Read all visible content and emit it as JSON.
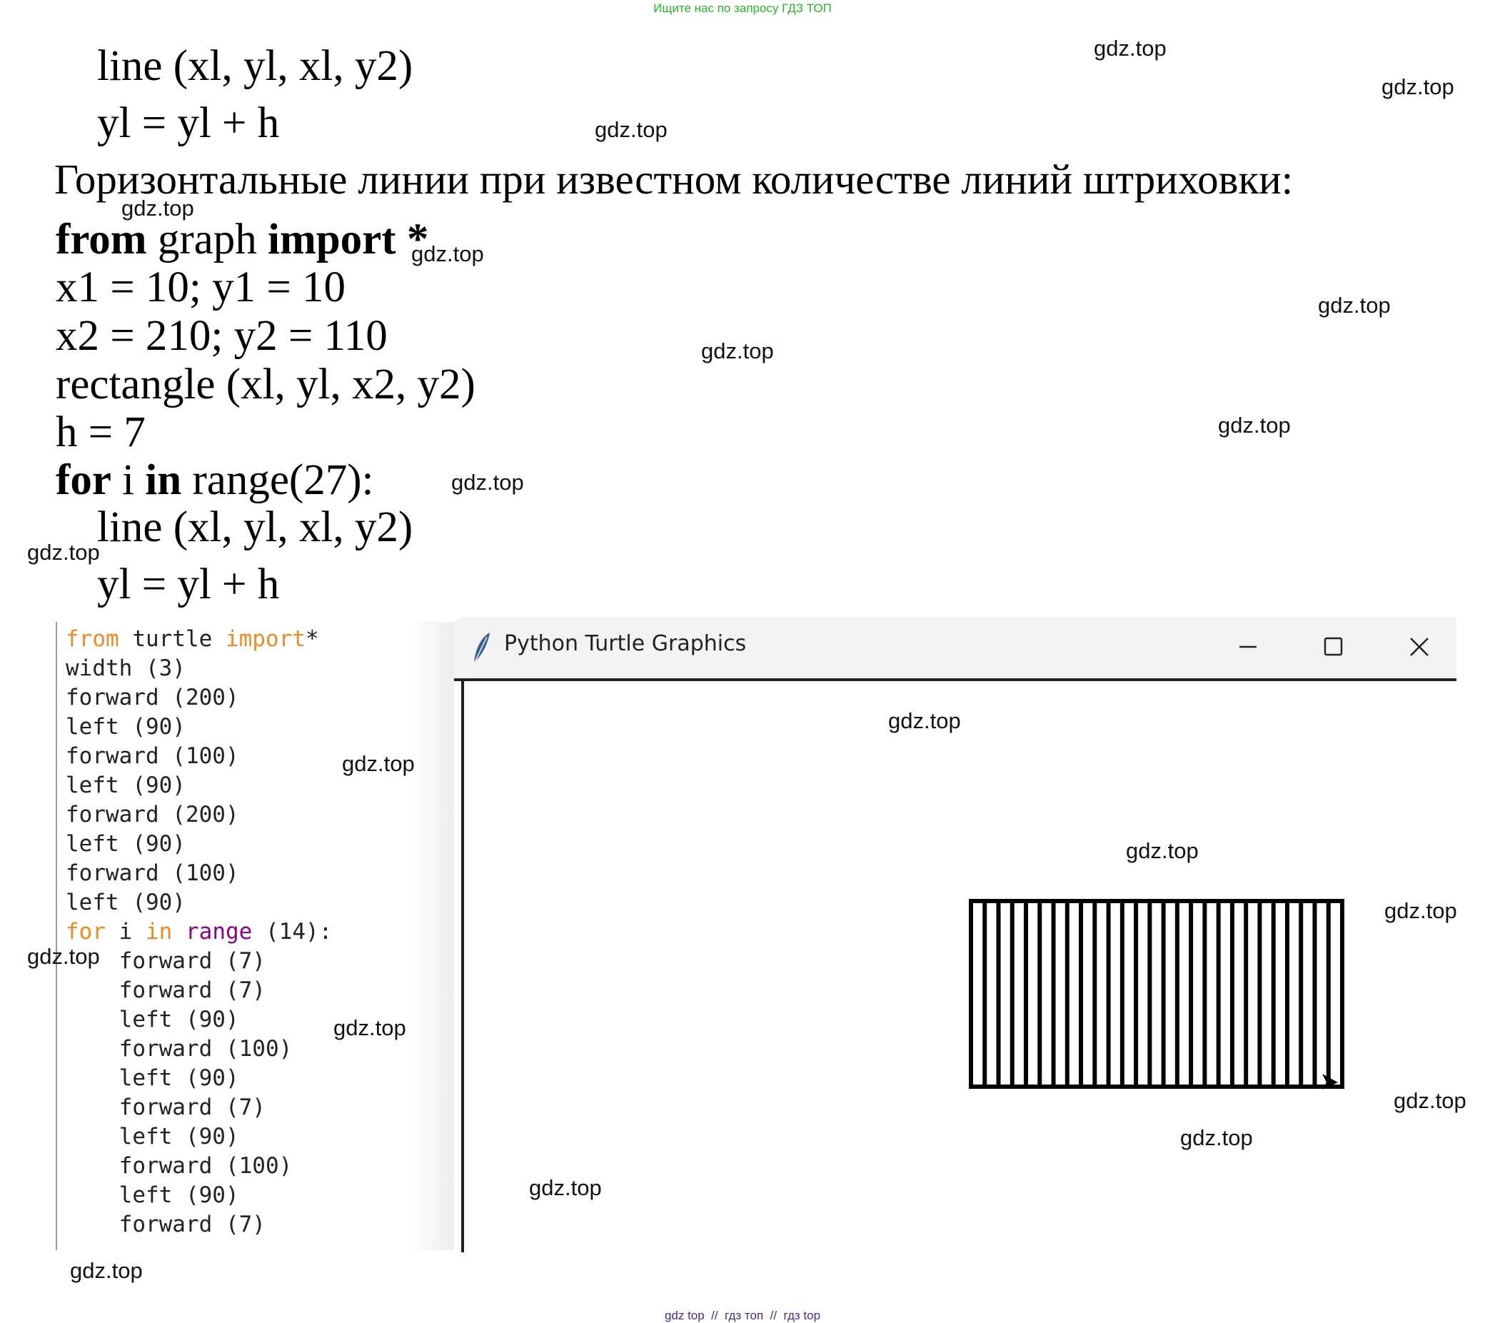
{
  "banner_top": "Ищите нас по запросу ГДЗ ТОП",
  "banner_bottom": "gdz top  //  гдз топ  //  гдз top",
  "doc": {
    "line1": "line (xl, yl, xl, y2)",
    "line2": "yl = yl + h",
    "heading": "Горизонтальные линии при известном количестве линий штриховки:",
    "from_kw": "from",
    "graph_word": " graph ",
    "import_kw": "import",
    "star": " *",
    "assign1": "x1 = 10; y1 = 10",
    "assign2": "x2 = 210; y2 = 110",
    "rect": "rectangle (xl, yl, x2, y2)",
    "h_assign": "h = 7",
    "for_kw": "for",
    "for_i": " i ",
    "in_kw": "in",
    "for_rest": " range(27):",
    "loop_line": "line (xl, yl, xl, y2)",
    "loop_inc": "yl = yl + h"
  },
  "editor": {
    "l1_kw1": "from",
    "l1_mid": " turtle ",
    "l1_kw2": "import",
    "l1_end": "*",
    "l2": "width (3)",
    "l3": "forward (200)",
    "l4": "left (90)",
    "l5": "forward (100)",
    "l6": "left (90)",
    "l7": "forward (200)",
    "l8": "left (90)",
    "l9": "forward (100)",
    "l10": "left (90)",
    "l11_for": "for",
    "l11_i": " i ",
    "l11_in": "in",
    "l11_sp": " ",
    "l11_range": "range",
    "l11_end": " (14):",
    "l12": "    forward (7)",
    "l13": "    forward (7)",
    "l14": "    left (90)",
    "l15": "    forward (100)",
    "l16": "    left (90)",
    "l17": "    forward (7)",
    "l18": "    left (90)",
    "l19": "    forward (100)",
    "l20": "    left (90)",
    "l21": "    forward (7)"
  },
  "window": {
    "title": "Python Turtle Graphics",
    "minimize_icon": "minimize-icon",
    "maximize_icon": "maximize-icon",
    "close_icon": "close-icon",
    "app_icon": "feather-icon"
  },
  "drawing": {
    "stripes": 27,
    "stroke": "#000000"
  },
  "watermark": "gdz.top",
  "colors": {
    "banner_top": "#22bb22",
    "banner_bottom": "#4b2a8c",
    "keyword": "#f08a24",
    "builtin": "#900090"
  }
}
